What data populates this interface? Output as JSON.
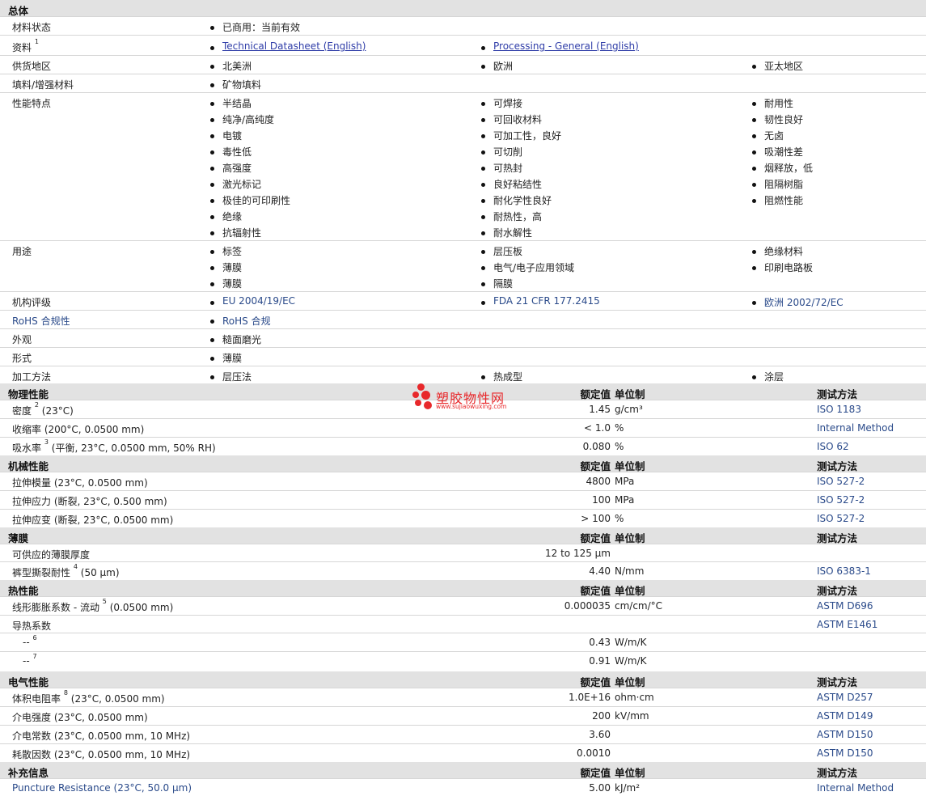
{
  "general": {
    "title": "总体",
    "rows": [
      {
        "label": "材料状态",
        "items": [
          "已商用：当前有效"
        ]
      },
      {
        "label": "资料",
        "sup": "1",
        "links": [
          "Technical Datasheet (English)",
          "Processing - General (English)"
        ]
      },
      {
        "label": "供货地区",
        "items": [
          "北美洲",
          "欧洲",
          "亚太地区"
        ]
      },
      {
        "label": "填料/增强材料",
        "items": [
          "矿物填料"
        ]
      },
      {
        "label": "性能特点",
        "col1": [
          "半结晶",
          "纯净/高纯度",
          "电镀",
          "毒性低",
          "高强度",
          "激光标记",
          "极佳的可印刷性",
          "绝缘",
          "抗辐射性"
        ],
        "col2": [
          "可焊接",
          "可回收材料",
          "可加工性，良好",
          "可切削",
          "可热封",
          "良好粘结性",
          "耐化学性良好",
          "耐热性，高",
          "耐水解性"
        ],
        "col3": [
          "耐用性",
          "韧性良好",
          "无卤",
          "吸潮性差",
          "烟释放，低",
          "阻隔树脂",
          "阻燃性能"
        ]
      },
      {
        "label": "用途",
        "col1": [
          "标签",
          "薄膜",
          "薄膜"
        ],
        "col2": [
          "层压板",
          "电气/电子应用领域",
          "隔膜"
        ],
        "col3": [
          "绝缘材料",
          "印刷电路板"
        ]
      },
      {
        "label": "机构评级",
        "items": [
          "EU 2004/19/EC",
          "FDA 21 CFR 177.2415",
          "欧洲  2002/72/EC"
        ]
      },
      {
        "label": "RoHS 合规性",
        "items": [
          "RoHS 合规"
        ]
      },
      {
        "label": "外观",
        "items": [
          "糙面磨光"
        ]
      },
      {
        "label": "形式",
        "items": [
          "薄膜"
        ]
      },
      {
        "label": "加工方法",
        "items": [
          "层压法",
          "热成型",
          "涂层"
        ]
      }
    ]
  },
  "headers": {
    "value": "额定值",
    "unit": "单位制",
    "method": "测试方法"
  },
  "physical": {
    "title": "物理性能",
    "rows": [
      {
        "label": "密度",
        "sup": "2",
        "cond": "(23°C)",
        "value": "1.45",
        "unit": "g/cm³",
        "method": "ISO 1183"
      },
      {
        "label": "收缩率",
        "sup": "",
        "cond": "(200°C, 0.0500 mm)",
        "value": "< 1.0",
        "unit": "%",
        "method": "Internal Method"
      },
      {
        "label": "吸水率",
        "sup": "3",
        "cond": "(平衡, 23°C, 0.0500 mm, 50% RH)",
        "value": "0.080",
        "unit": "%",
        "method": "ISO 62"
      }
    ]
  },
  "mechanical": {
    "title": "机械性能",
    "rows": [
      {
        "label": "拉伸模量",
        "sup": "",
        "cond": "(23°C, 0.0500 mm)",
        "value": "4800",
        "unit": "MPa",
        "method": "ISO 527-2"
      },
      {
        "label": "拉伸应力",
        "sup": "",
        "cond": "(断裂, 23°C, 0.500 mm)",
        "value": "100",
        "unit": "MPa",
        "method": "ISO 527-2"
      },
      {
        "label": "拉伸应变",
        "sup": "",
        "cond": "(断裂, 23°C, 0.0500 mm)",
        "value": "> 100",
        "unit": "%",
        "method": "ISO 527-2"
      }
    ]
  },
  "film": {
    "title": "薄膜",
    "rows": [
      {
        "label": "可供应的薄膜厚度",
        "sup": "",
        "cond": "",
        "value": "12 to 125 µm",
        "unit": "",
        "method": ""
      },
      {
        "label": "裤型撕裂耐性",
        "sup": "4",
        "cond": "(50 µm)",
        "value": "4.40",
        "unit": "N/mm",
        "method": "ISO 6383-1"
      }
    ]
  },
  "thermal": {
    "title": "热性能",
    "rows": [
      {
        "label": "线形膨胀系数  - 流动",
        "sup": "5",
        "cond": "(0.0500 mm)",
        "value": "0.000035",
        "unit": "cm/cm/°C",
        "method": "ASTM D696"
      },
      {
        "label": "导热系数",
        "sup": "",
        "cond": "",
        "value": "",
        "unit": "",
        "method": "ASTM E1461"
      },
      {
        "label": "--",
        "sup": "6",
        "cond": "",
        "value": "0.43",
        "unit": "W/m/K",
        "method": ""
      },
      {
        "label": "--",
        "sup": "7",
        "cond": "",
        "value": "0.91",
        "unit": "W/m/K",
        "method": ""
      }
    ]
  },
  "electrical": {
    "title": "电气性能",
    "rows": [
      {
        "label": "体积电阻率",
        "sup": "8",
        "cond": "(23°C, 0.0500 mm)",
        "value": "1.0E+16",
        "unit": "ohm·cm",
        "method": "ASTM D257"
      },
      {
        "label": "介电强度",
        "sup": "",
        "cond": "(23°C, 0.0500 mm)",
        "value": "200",
        "unit": "kV/mm",
        "method": "ASTM D149"
      },
      {
        "label": "介电常数",
        "sup": "",
        "cond": "(23°C, 0.0500 mm, 10 MHz)",
        "value": "3.60",
        "unit": "",
        "method": "ASTM D150"
      },
      {
        "label": "耗散因数",
        "sup": "",
        "cond": "(23°C, 0.0500 mm, 10 MHz)",
        "value": "0.0010",
        "unit": "",
        "method": "ASTM D150"
      }
    ]
  },
  "supplemental": {
    "title": "补充信息",
    "rows": [
      {
        "label": "Puncture Resistance",
        "sup": "",
        "cond": "(23°C, 50.0 µm)",
        "value": "5.00",
        "unit": "kJ/m²",
        "method": "Internal Method"
      }
    ]
  },
  "watermark": {
    "name": "塑胶物性网",
    "url": "www.sujiaowuxing.com"
  },
  "colors": {
    "section_bg": "#e2e2e2",
    "link": "#2f3da8",
    "method": "#2a4a8a",
    "watermark": "#e8282b"
  }
}
